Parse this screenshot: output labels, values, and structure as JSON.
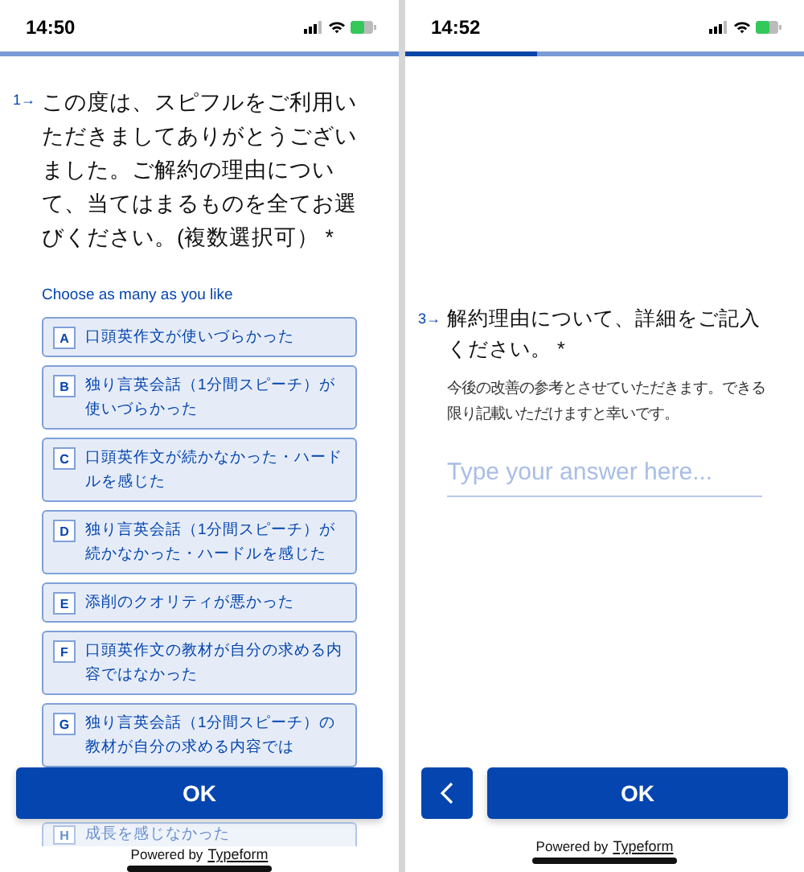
{
  "screens": [
    {
      "status_bar": {
        "time": "14:50"
      },
      "question": {
        "number": "1",
        "arrow": "→",
        "text": "この度は、スピフルをご利用いただきましてありがとうございました。ご解約の理由について、当てはまるものを全てお選びください。(複数選択可）",
        "required": "*"
      },
      "hint": "Choose as many as you like",
      "options": [
        {
          "key": "A",
          "label": "口頭英作文が使いづらかった",
          "selected": false
        },
        {
          "key": "B",
          "label": "独り言英会話（1分間スピーチ）が使いづらかった",
          "selected": false
        },
        {
          "key": "C",
          "label": "口頭英作文が続かなかった・ハードルを感じた",
          "selected": false
        },
        {
          "key": "D",
          "label": "独り言英会話（1分間スピーチ）が続かなかった・ハードルを感じた",
          "selected": false
        },
        {
          "key": "E",
          "label": "添削のクオリティが悪かった",
          "selected": false
        },
        {
          "key": "F",
          "label": "口頭英作文の教材が自分の求める内容ではなかった",
          "selected": false
        },
        {
          "key": "G",
          "label": "独り言英会話（1分間スピーチ）の教材が自分の求める内容では",
          "selected": false
        },
        {
          "key": "H",
          "label": "成長を感じなかった",
          "selected": false
        }
      ],
      "ok_button": "OK",
      "footer": {
        "prefix": "Powered by",
        "brand": "Typeform"
      }
    },
    {
      "status_bar": {
        "time": "14:52"
      },
      "progress": {
        "level": 0.33
      },
      "question": {
        "number": "3",
        "arrow": "→",
        "text": "解約理由について、詳細をご記入ください。",
        "required": "*"
      },
      "description": "今後の改善の参考とさせていただきます。できる限り記載いただけますと幸いです。",
      "answer": {
        "placeholder": "Type your answer here..."
      },
      "back_button": true,
      "ok_button": "OK",
      "footer": {
        "prefix": "Powered by",
        "brand": "Typeform"
      }
    }
  ]
}
